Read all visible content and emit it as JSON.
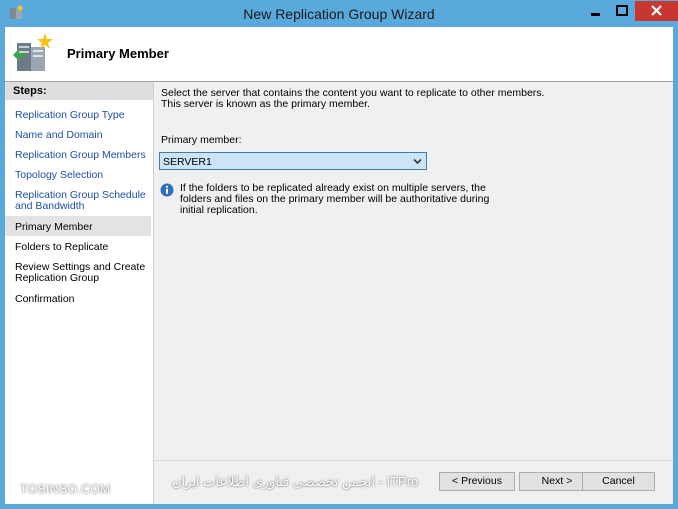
{
  "window": {
    "title": "New Replication Group Wizard"
  },
  "header": {
    "title": "Primary Member"
  },
  "steps": {
    "heading": "Steps:",
    "items": [
      {
        "label": "Replication Group Type"
      },
      {
        "label": "Name and Domain"
      },
      {
        "label": "Replication Group Members"
      },
      {
        "label": "Topology Selection"
      },
      {
        "label": "Replication Group Schedule and Bandwidth"
      },
      {
        "label": "Primary Member"
      },
      {
        "label": "Folders to Replicate"
      },
      {
        "label": "Review Settings and Create Replication Group"
      },
      {
        "label": "Confirmation"
      }
    ]
  },
  "main": {
    "description_line1": "Select the server that contains the content you want to replicate to other members.",
    "description_line2": "This server is known as the primary member.",
    "primary_member_label": "Primary member:",
    "primary_member_value": "SERVER1",
    "info_text": "If the folders to be replicated already exist on multiple servers, the folders and files on the primary member will be authoritative during initial replication."
  },
  "buttons": {
    "previous": "< Previous",
    "next": "Next >",
    "cancel": "Cancel"
  },
  "watermark": {
    "left": "TOSINSO.COM",
    "right": "ITPro - انجمن تخصصی فناوری اطلاعات ایران"
  },
  "colors": {
    "titlebar": "#5aa9dc",
    "close": "#c7372f",
    "link": "#1f4ea6",
    "select_bg": "#cce4f7"
  }
}
